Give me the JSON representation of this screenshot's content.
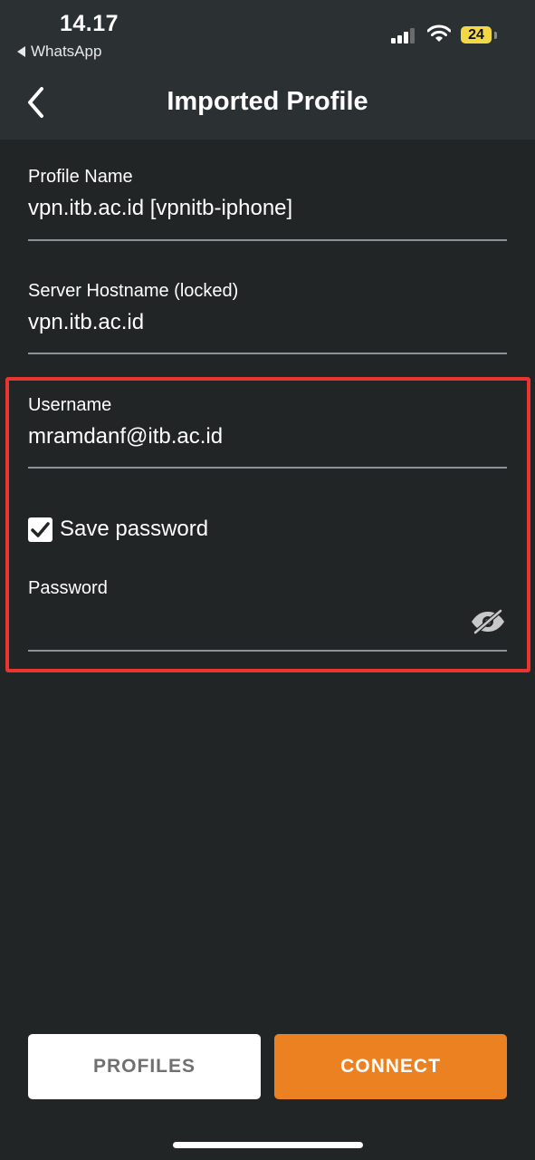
{
  "status_bar": {
    "time": "14.17",
    "back_app": "WhatsApp",
    "battery": "24"
  },
  "header": {
    "title": "Imported Profile",
    "back_icon": "chevron-left-icon"
  },
  "form": {
    "profile_name": {
      "label": "Profile Name",
      "value": "vpn.itb.ac.id [vpnitb-iphone]"
    },
    "server_hostname": {
      "label": "Server Hostname (locked)",
      "value": "vpn.itb.ac.id"
    },
    "username": {
      "label": "Username",
      "value": "mramdanf@itb.ac.id"
    },
    "save_password": {
      "label": "Save password",
      "checked": true
    },
    "password": {
      "label": "Password",
      "value": "",
      "toggle_icon": "eye-slash-icon"
    }
  },
  "buttons": {
    "profiles": "PROFILES",
    "connect": "CONNECT"
  },
  "colors": {
    "background": "#212526",
    "header": "#2b3032",
    "accent": "#ec8122",
    "highlight": "#e8352f",
    "battery": "#f3d846"
  }
}
